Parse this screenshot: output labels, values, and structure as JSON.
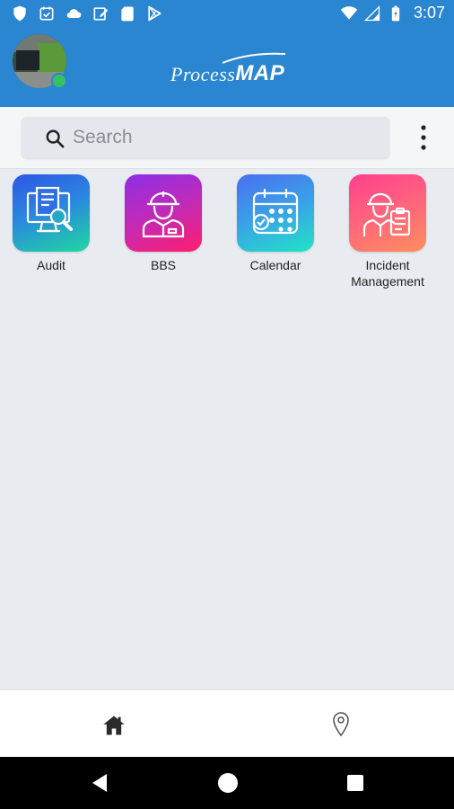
{
  "status_bar": {
    "time": "3:07",
    "left_icons": [
      "shield-icon",
      "calendar-check-icon",
      "cloud-icon",
      "edit-note-icon",
      "sd-card-icon",
      "play-store-icon"
    ],
    "right_icons": [
      "wifi-icon",
      "signal-icon",
      "battery-icon"
    ]
  },
  "header": {
    "logo_text_1": "Process",
    "logo_text_2": "MAP",
    "brand_color": "#2a86d0"
  },
  "search": {
    "placeholder": "Search"
  },
  "apps": [
    {
      "label": "Audit",
      "icon": "audit-icon",
      "gradient": [
        "#2d5be3",
        "#1fd3a0"
      ]
    },
    {
      "label": "BBS",
      "icon": "worker-icon",
      "gradient": [
        "#8a2be2",
        "#ff1e7a"
      ]
    },
    {
      "label": "Calendar",
      "icon": "calendar-icon",
      "gradient": [
        "#3e7cf0",
        "#20e0c8"
      ]
    },
    {
      "label": "Incident",
      "label2": "Management",
      "icon": "incident-worker-icon",
      "gradient": [
        "#ff4f8a",
        "#ff8a5a"
      ]
    }
  ],
  "bottom_nav": {
    "items": [
      "home-icon",
      "location-pin-icon"
    ]
  },
  "system_nav": {
    "items": [
      "back-button",
      "home-button",
      "recents-button"
    ]
  }
}
